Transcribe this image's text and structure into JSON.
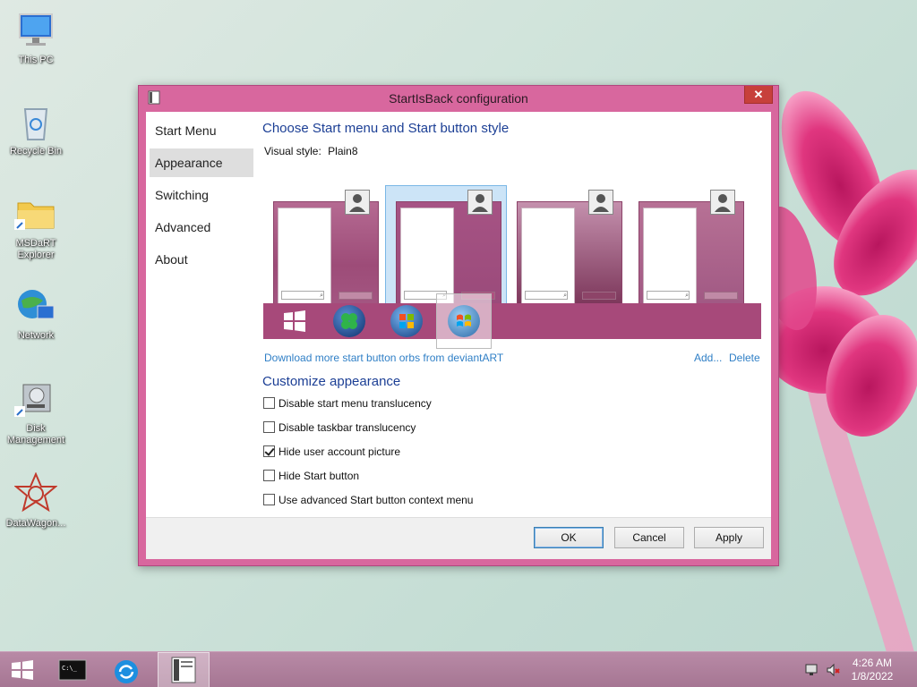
{
  "desktop": {
    "icons": [
      {
        "label": "This PC"
      },
      {
        "label": "Recycle Bin"
      },
      {
        "label": "MSDaRT Explorer"
      },
      {
        "label": "Network"
      },
      {
        "label": "Disk Management"
      },
      {
        "label": "DataWagon..."
      }
    ]
  },
  "window": {
    "title": "StartIsBack configuration",
    "close_label": "✕",
    "nav": [
      {
        "label": "Start Menu"
      },
      {
        "label": "Appearance"
      },
      {
        "label": "Switching"
      },
      {
        "label": "Advanced"
      },
      {
        "label": "About"
      }
    ],
    "active_nav": "Appearance",
    "style_heading": "Choose Start menu and Start button style",
    "visual_style_label": "Visual style:",
    "visual_style_value": "Plain8",
    "selected_style_index": 1,
    "orbs": [
      "windows-8-orb-icon",
      "clover-orb-icon",
      "windows-7-orb-icon",
      "vista-orb-icon"
    ],
    "selected_orb_index": 3,
    "download_link": "Download more start button orbs from deviantART",
    "add_link": "Add...",
    "delete_link": "Delete",
    "customize_heading": "Customize appearance",
    "options": [
      {
        "label": "Disable start menu translucency",
        "checked": false
      },
      {
        "label": "Disable taskbar translucency",
        "checked": false
      },
      {
        "label": "Hide user account picture",
        "checked": true
      },
      {
        "label": "Hide Start button",
        "checked": false
      },
      {
        "label": "Use advanced Start button context menu",
        "checked": false
      }
    ],
    "buttons": {
      "ok": "OK",
      "cancel": "Cancel",
      "apply": "Apply"
    }
  },
  "taskbar": {
    "time": "4:26 AM",
    "date": "1/8/2022"
  },
  "colors": {
    "accent": "#d8679e",
    "heading": "#1c3f95",
    "link": "#2f7fc6"
  }
}
